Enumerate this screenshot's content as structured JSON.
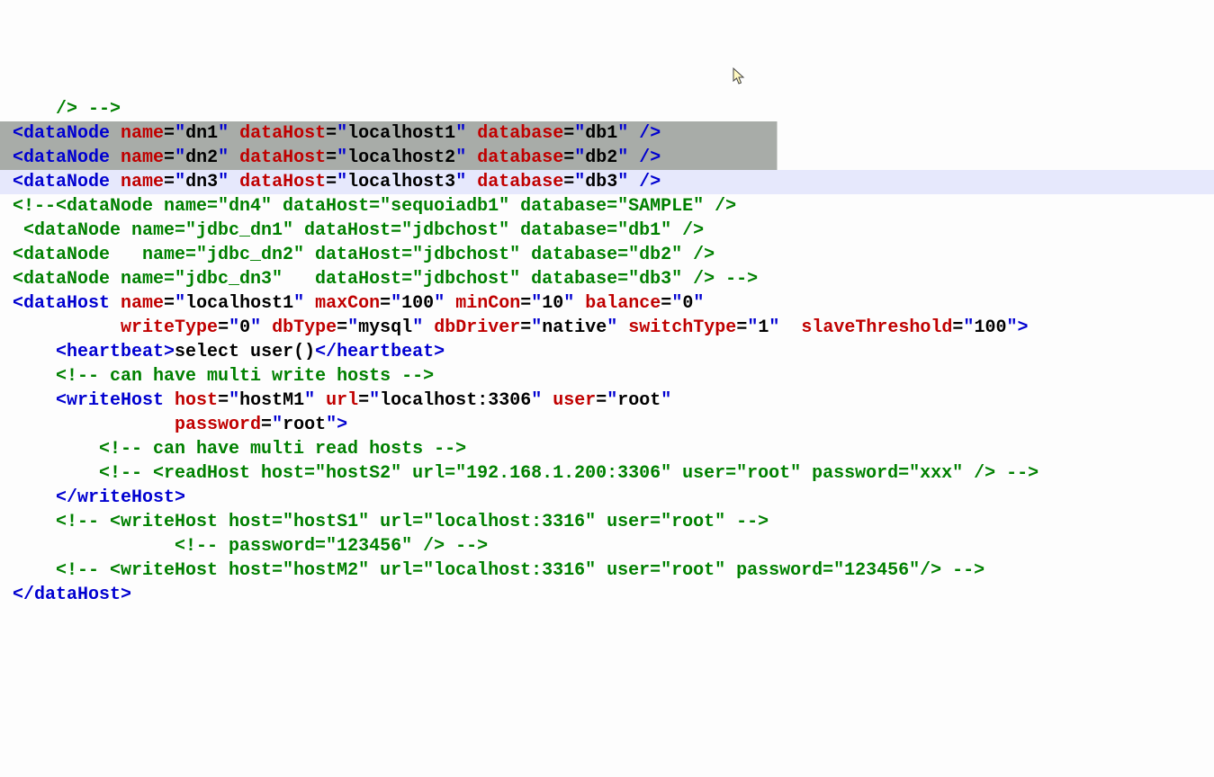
{
  "lines": [
    {
      "cls": "",
      "tokens": [
        {
          "c": "cmt",
          "t": "    /> -->"
        }
      ]
    },
    {
      "cls": "sel1",
      "tokens": [
        {
          "c": "tag",
          "t": "<dataNode "
        },
        {
          "c": "attr",
          "t": "name"
        },
        {
          "c": "eq",
          "t": "="
        },
        {
          "c": "tag",
          "t": "\""
        },
        {
          "c": "val",
          "t": "dn1"
        },
        {
          "c": "tag",
          "t": "\" "
        },
        {
          "c": "attr",
          "t": "dataHost"
        },
        {
          "c": "eq",
          "t": "="
        },
        {
          "c": "tag",
          "t": "\""
        },
        {
          "c": "val",
          "t": "localhost1"
        },
        {
          "c": "tag",
          "t": "\" "
        },
        {
          "c": "attr",
          "t": "database"
        },
        {
          "c": "eq",
          "t": "="
        },
        {
          "c": "tag",
          "t": "\""
        },
        {
          "c": "val",
          "t": "db1"
        },
        {
          "c": "tag",
          "t": "\" />"
        }
      ]
    },
    {
      "cls": "sel2",
      "tokens": [
        {
          "c": "tag",
          "t": "<dataNode "
        },
        {
          "c": "attr",
          "t": "name"
        },
        {
          "c": "eq",
          "t": "="
        },
        {
          "c": "tag",
          "t": "\""
        },
        {
          "c": "val",
          "t": "dn2"
        },
        {
          "c": "tag",
          "t": "\" "
        },
        {
          "c": "attr",
          "t": "dataHost"
        },
        {
          "c": "eq",
          "t": "="
        },
        {
          "c": "tag",
          "t": "\""
        },
        {
          "c": "val",
          "t": "localhost2"
        },
        {
          "c": "tag",
          "t": "\" "
        },
        {
          "c": "attr",
          "t": "database"
        },
        {
          "c": "eq",
          "t": "="
        },
        {
          "c": "tag",
          "t": "\""
        },
        {
          "c": "val",
          "t": "db2"
        },
        {
          "c": "tag",
          "t": "\" />"
        }
      ]
    },
    {
      "cls": "hl",
      "tokens": [
        {
          "c": "tag",
          "t": "<dataNode "
        },
        {
          "c": "attr",
          "t": "name"
        },
        {
          "c": "eq",
          "t": "="
        },
        {
          "c": "tag",
          "t": "\""
        },
        {
          "c": "val",
          "t": "dn3"
        },
        {
          "c": "tag",
          "t": "\" "
        },
        {
          "c": "attr",
          "t": "dataHost"
        },
        {
          "c": "eq",
          "t": "="
        },
        {
          "c": "tag",
          "t": "\""
        },
        {
          "c": "val",
          "t": "localhost3"
        },
        {
          "c": "tag",
          "t": "\" "
        },
        {
          "c": "attr",
          "t": "database"
        },
        {
          "c": "eq",
          "t": "="
        },
        {
          "c": "tag",
          "t": "\""
        },
        {
          "c": "val",
          "t": "db3"
        },
        {
          "c": "tag",
          "t": "\" />"
        }
      ]
    },
    {
      "cls": "",
      "tokens": [
        {
          "c": "cmt",
          "t": "<!--<dataNode name=\"dn4\" dataHost=\"sequoiadb1\" database=\"SAMPLE\" />"
        }
      ]
    },
    {
      "cls": "",
      "tokens": [
        {
          "c": "cmt",
          "t": " <dataNode name=\"jdbc_dn1\" dataHost=\"jdbchost\" database=\"db1\" />"
        }
      ]
    },
    {
      "cls": "",
      "tokens": [
        {
          "c": "cmt",
          "t": "<dataNode   name=\"jdbc_dn2\" dataHost=\"jdbchost\" database=\"db2\" />"
        }
      ]
    },
    {
      "cls": "",
      "tokens": [
        {
          "c": "cmt",
          "t": "<dataNode name=\"jdbc_dn3\"   dataHost=\"jdbchost\" database=\"db3\" /> -->"
        }
      ]
    },
    {
      "cls": "",
      "tokens": [
        {
          "c": "tag",
          "t": "<dataHost "
        },
        {
          "c": "attr",
          "t": "name"
        },
        {
          "c": "eq",
          "t": "="
        },
        {
          "c": "tag",
          "t": "\""
        },
        {
          "c": "val",
          "t": "localhost1"
        },
        {
          "c": "tag",
          "t": "\" "
        },
        {
          "c": "attr",
          "t": "maxCon"
        },
        {
          "c": "eq",
          "t": "="
        },
        {
          "c": "tag",
          "t": "\""
        },
        {
          "c": "val",
          "t": "100"
        },
        {
          "c": "tag",
          "t": "\" "
        },
        {
          "c": "attr",
          "t": "minCon"
        },
        {
          "c": "eq",
          "t": "="
        },
        {
          "c": "tag",
          "t": "\""
        },
        {
          "c": "val",
          "t": "10"
        },
        {
          "c": "tag",
          "t": "\" "
        },
        {
          "c": "attr",
          "t": "balance"
        },
        {
          "c": "eq",
          "t": "="
        },
        {
          "c": "tag",
          "t": "\""
        },
        {
          "c": "val",
          "t": "0"
        },
        {
          "c": "tag",
          "t": "\""
        }
      ]
    },
    {
      "cls": "",
      "tokens": [
        {
          "c": "txt",
          "t": "          "
        },
        {
          "c": "attr",
          "t": "writeType"
        },
        {
          "c": "eq",
          "t": "="
        },
        {
          "c": "tag",
          "t": "\""
        },
        {
          "c": "val",
          "t": "0"
        },
        {
          "c": "tag",
          "t": "\" "
        },
        {
          "c": "attr",
          "t": "dbType"
        },
        {
          "c": "eq",
          "t": "="
        },
        {
          "c": "tag",
          "t": "\""
        },
        {
          "c": "val",
          "t": "mysql"
        },
        {
          "c": "tag",
          "t": "\" "
        },
        {
          "c": "attr",
          "t": "dbDriver"
        },
        {
          "c": "eq",
          "t": "="
        },
        {
          "c": "tag",
          "t": "\""
        },
        {
          "c": "val",
          "t": "native"
        },
        {
          "c": "tag",
          "t": "\" "
        },
        {
          "c": "attr",
          "t": "switchType"
        },
        {
          "c": "eq",
          "t": "="
        },
        {
          "c": "tag",
          "t": "\""
        },
        {
          "c": "val",
          "t": "1"
        },
        {
          "c": "tag",
          "t": "\"  "
        },
        {
          "c": "attr",
          "t": "slaveThreshold"
        },
        {
          "c": "eq",
          "t": "="
        },
        {
          "c": "tag",
          "t": "\""
        },
        {
          "c": "val",
          "t": "100"
        },
        {
          "c": "tag",
          "t": "\">"
        }
      ]
    },
    {
      "cls": "",
      "tokens": [
        {
          "c": "txt",
          "t": "    "
        },
        {
          "c": "tag",
          "t": "<heartbeat>"
        },
        {
          "c": "txt",
          "t": "select user()"
        },
        {
          "c": "tag",
          "t": "</heartbeat>"
        }
      ]
    },
    {
      "cls": "",
      "tokens": [
        {
          "c": "txt",
          "t": "    "
        },
        {
          "c": "cmt",
          "t": "<!-- can have multi write hosts -->"
        }
      ]
    },
    {
      "cls": "",
      "tokens": [
        {
          "c": "txt",
          "t": "    "
        },
        {
          "c": "tag",
          "t": "<writeHost "
        },
        {
          "c": "attr",
          "t": "host"
        },
        {
          "c": "eq",
          "t": "="
        },
        {
          "c": "tag",
          "t": "\""
        },
        {
          "c": "val",
          "t": "hostM1"
        },
        {
          "c": "tag",
          "t": "\" "
        },
        {
          "c": "attr",
          "t": "url"
        },
        {
          "c": "eq",
          "t": "="
        },
        {
          "c": "tag",
          "t": "\""
        },
        {
          "c": "val",
          "t": "localhost:3306"
        },
        {
          "c": "tag",
          "t": "\" "
        },
        {
          "c": "attr",
          "t": "user"
        },
        {
          "c": "eq",
          "t": "="
        },
        {
          "c": "tag",
          "t": "\""
        },
        {
          "c": "val",
          "t": "root"
        },
        {
          "c": "tag",
          "t": "\""
        }
      ]
    },
    {
      "cls": "",
      "tokens": [
        {
          "c": "txt",
          "t": "               "
        },
        {
          "c": "attr",
          "t": "password"
        },
        {
          "c": "eq",
          "t": "="
        },
        {
          "c": "tag",
          "t": "\""
        },
        {
          "c": "val",
          "t": "root"
        },
        {
          "c": "tag",
          "t": "\">"
        }
      ]
    },
    {
      "cls": "",
      "tokens": [
        {
          "c": "txt",
          "t": "        "
        },
        {
          "c": "cmt",
          "t": "<!-- can have multi read hosts -->"
        }
      ]
    },
    {
      "cls": "",
      "tokens": [
        {
          "c": "txt",
          "t": "        "
        },
        {
          "c": "cmt",
          "t": "<!-- <readHost host=\"hostS2\" url=\"192.168.1.200:3306\" user=\"root\" password=\"xxx\" /> -->"
        }
      ]
    },
    {
      "cls": "",
      "tokens": [
        {
          "c": "txt",
          "t": "    "
        },
        {
          "c": "tag",
          "t": "</writeHost>"
        }
      ]
    },
    {
      "cls": "",
      "tokens": [
        {
          "c": "txt",
          "t": "    "
        },
        {
          "c": "cmt",
          "t": "<!-- <writeHost host=\"hostS1\" url=\"localhost:3316\" user=\"root\" -->"
        }
      ]
    },
    {
      "cls": "",
      "tokens": [
        {
          "c": "txt",
          "t": "               "
        },
        {
          "c": "cmt",
          "t": "<!-- password=\"123456\" /> -->"
        }
      ]
    },
    {
      "cls": "",
      "tokens": [
        {
          "c": "txt",
          "t": "    "
        },
        {
          "c": "cmt",
          "t": "<!-- <writeHost host=\"hostM2\" url=\"localhost:3316\" user=\"root\" password=\"123456\"/> -->"
        }
      ]
    },
    {
      "cls": "",
      "tokens": [
        {
          "c": "tag",
          "t": "</dataHost>"
        }
      ]
    }
  ]
}
